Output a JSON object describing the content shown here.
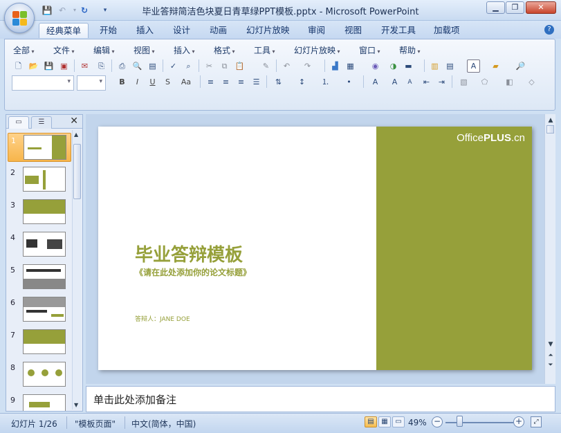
{
  "window": {
    "title": "毕业答辩简洁色块夏日青草绿PPT模板.pptx - Microsoft PowerPoint"
  },
  "ribbon_tabs": [
    "经典菜单",
    "开始",
    "插入",
    "设计",
    "动画",
    "幻灯片放映",
    "审阅",
    "视图",
    "开发工具",
    "加载项"
  ],
  "classic_menu": [
    "全部",
    "文件",
    "编辑",
    "视图",
    "插入",
    "格式",
    "工具",
    "幻灯片放映",
    "窗口",
    "帮助"
  ],
  "font_buttons": {
    "bold": "B",
    "italic": "I",
    "underline": "U",
    "shadow": "S",
    "change_case": "Aa"
  },
  "thumbnails": [
    {
      "number": "1",
      "selected": true
    },
    {
      "number": "2",
      "selected": false
    },
    {
      "number": "3",
      "selected": false
    },
    {
      "number": "4",
      "selected": false
    },
    {
      "number": "5",
      "selected": false
    },
    {
      "number": "6",
      "selected": false
    },
    {
      "number": "7",
      "selected": false
    },
    {
      "number": "8",
      "selected": false
    },
    {
      "number": "9",
      "selected": false
    }
  ],
  "slide": {
    "brand_plain": "Office",
    "brand_bold": "PLUS",
    "brand_suffix": ".cn",
    "title": "毕业答辩模板",
    "subtitle": "《请在此处添加你的论文标题》",
    "presenter": "答辩人：JANE DOE",
    "accent_color": "#96a03a"
  },
  "notes": {
    "placeholder": "单击此处添加备注"
  },
  "status": {
    "slide_counter": "幻灯片 1/26",
    "theme": "\"模板页面\"",
    "language": "中文(简体，中国)",
    "zoom": "49%"
  }
}
